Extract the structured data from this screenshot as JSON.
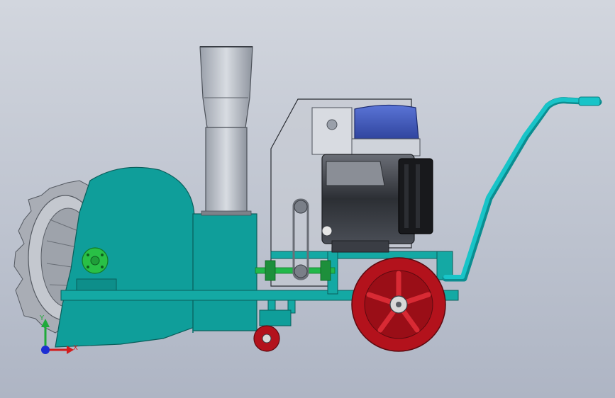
{
  "viewport": {
    "background_top": "#d2d6de",
    "background_bottom": "#aeb5c4"
  },
  "colors": {
    "teal_body": "#0f9e9a",
    "teal_dark": "#0a7e7b",
    "handle_cyan": "#18c4c8",
    "wheel_red": "#b3121c",
    "wheel_red_dark": "#7a0a10",
    "motor_blue": "#3b55b8",
    "shaft_green": "#22b84a",
    "guard_gray": "#c8ccd4",
    "motor_gray": "#3a3d44"
  },
  "triad": {
    "x_label": "X",
    "y_label": "Y",
    "x_color": "#d31c1c",
    "y_color": "#1faa3a",
    "z_color": "#1c2ed3"
  }
}
